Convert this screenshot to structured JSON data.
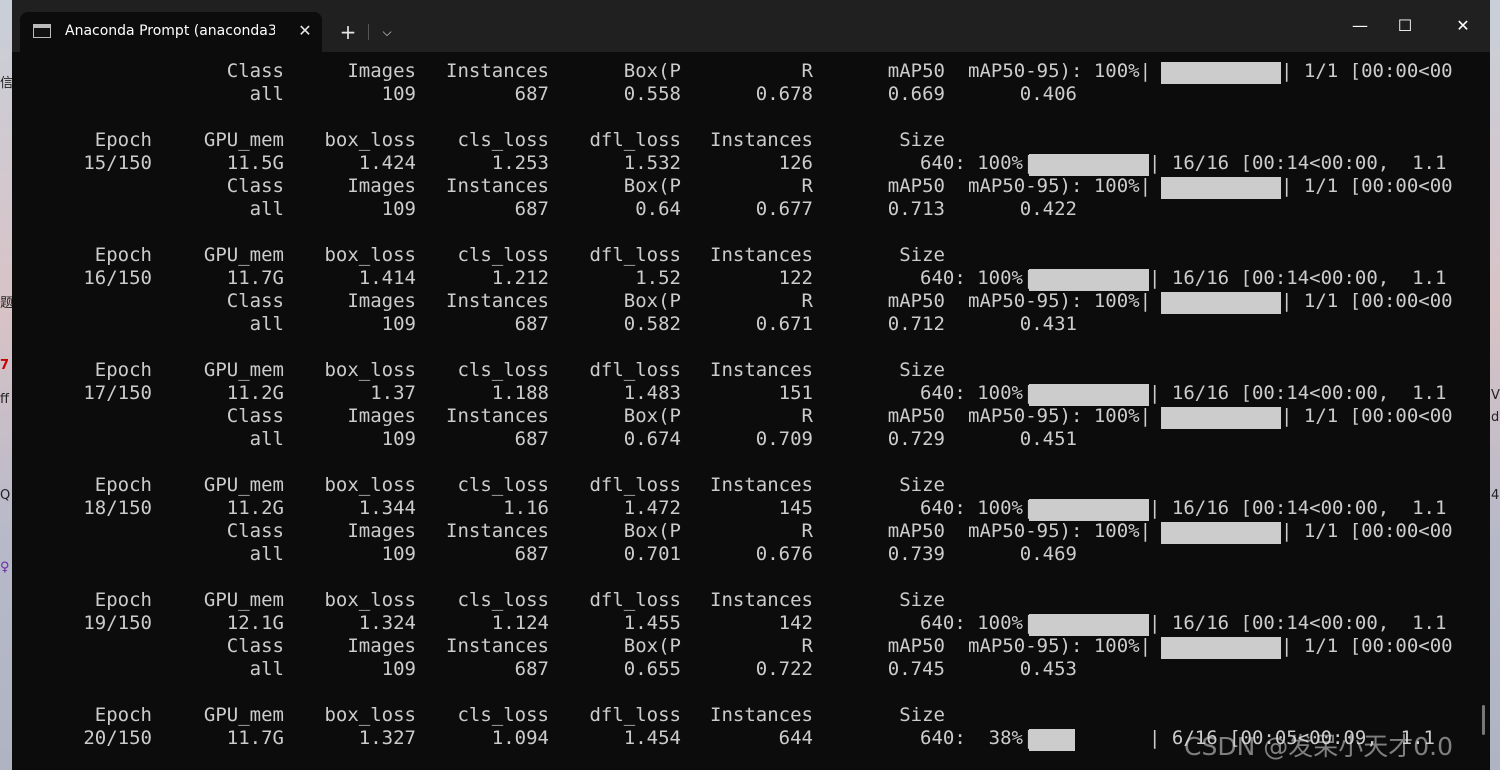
{
  "window": {
    "tab_title": "Anaconda Prompt (anaconda3",
    "close_tab": "✕",
    "new_tab": "+",
    "dropdown": "⌵",
    "minimize": "—",
    "maximize": "☐",
    "close": "✕"
  },
  "desktop": {
    "left_glyphs": [
      "信",
      "题",
      "7",
      "ff",
      "Q",
      "♀"
    ],
    "right_glyphs": [
      "V",
      "d",
      "4"
    ]
  },
  "terminal": {
    "class_header": [
      "Class",
      "Images",
      "Instances",
      "Box(P",
      "R",
      "mAP50",
      "mAP50-95): 100%|",
      "| 1/1 [00:00<00"
    ],
    "epoch_header": [
      "Epoch",
      "GPU_mem",
      "box_loss",
      "cls_loss",
      "dfl_loss",
      "Instances",
      "Size"
    ],
    "first_all_row": [
      "all",
      "109",
      "687",
      "0.558",
      "0.678",
      "0.669",
      "0.406"
    ],
    "epochs": [
      {
        "train": [
          "15/150",
          "11.5G",
          "1.424",
          "1.253",
          "1.532",
          "126",
          "640: 100%|",
          "| 16/16 [00:14<00:00,  1.1"
        ],
        "val": [
          "all",
          "109",
          "687",
          "0.64",
          "0.677",
          "0.713",
          "0.422"
        ]
      },
      {
        "train": [
          "16/150",
          "11.7G",
          "1.414",
          "1.212",
          "1.52",
          "122",
          "640: 100%|",
          "| 16/16 [00:14<00:00,  1.1"
        ],
        "val": [
          "all",
          "109",
          "687",
          "0.582",
          "0.671",
          "0.712",
          "0.431"
        ]
      },
      {
        "train": [
          "17/150",
          "11.2G",
          "1.37",
          "1.188",
          "1.483",
          "151",
          "640: 100%|",
          "| 16/16 [00:14<00:00,  1.1"
        ],
        "val": [
          "all",
          "109",
          "687",
          "0.674",
          "0.709",
          "0.729",
          "0.451"
        ]
      },
      {
        "train": [
          "18/150",
          "11.2G",
          "1.344",
          "1.16",
          "1.472",
          "145",
          "640: 100%|",
          "| 16/16 [00:14<00:00,  1.1"
        ],
        "val": [
          "all",
          "109",
          "687",
          "0.701",
          "0.676",
          "0.739",
          "0.469"
        ]
      },
      {
        "train": [
          "19/150",
          "12.1G",
          "1.324",
          "1.124",
          "1.455",
          "142",
          "640: 100%|",
          "| 16/16 [00:14<00:00,  1.1"
        ],
        "val": [
          "all",
          "109",
          "687",
          "0.655",
          "0.722",
          "0.745",
          "0.453"
        ]
      }
    ],
    "current": [
      "20/150",
      "11.7G",
      "1.327",
      "1.094",
      "1.454",
      "644",
      "640:  38%|",
      "| 6/16 [00:05<00:09,  1.1"
    ],
    "current_progress": 0.38,
    "watermark": "CSDN @发呆小天才0.0"
  }
}
